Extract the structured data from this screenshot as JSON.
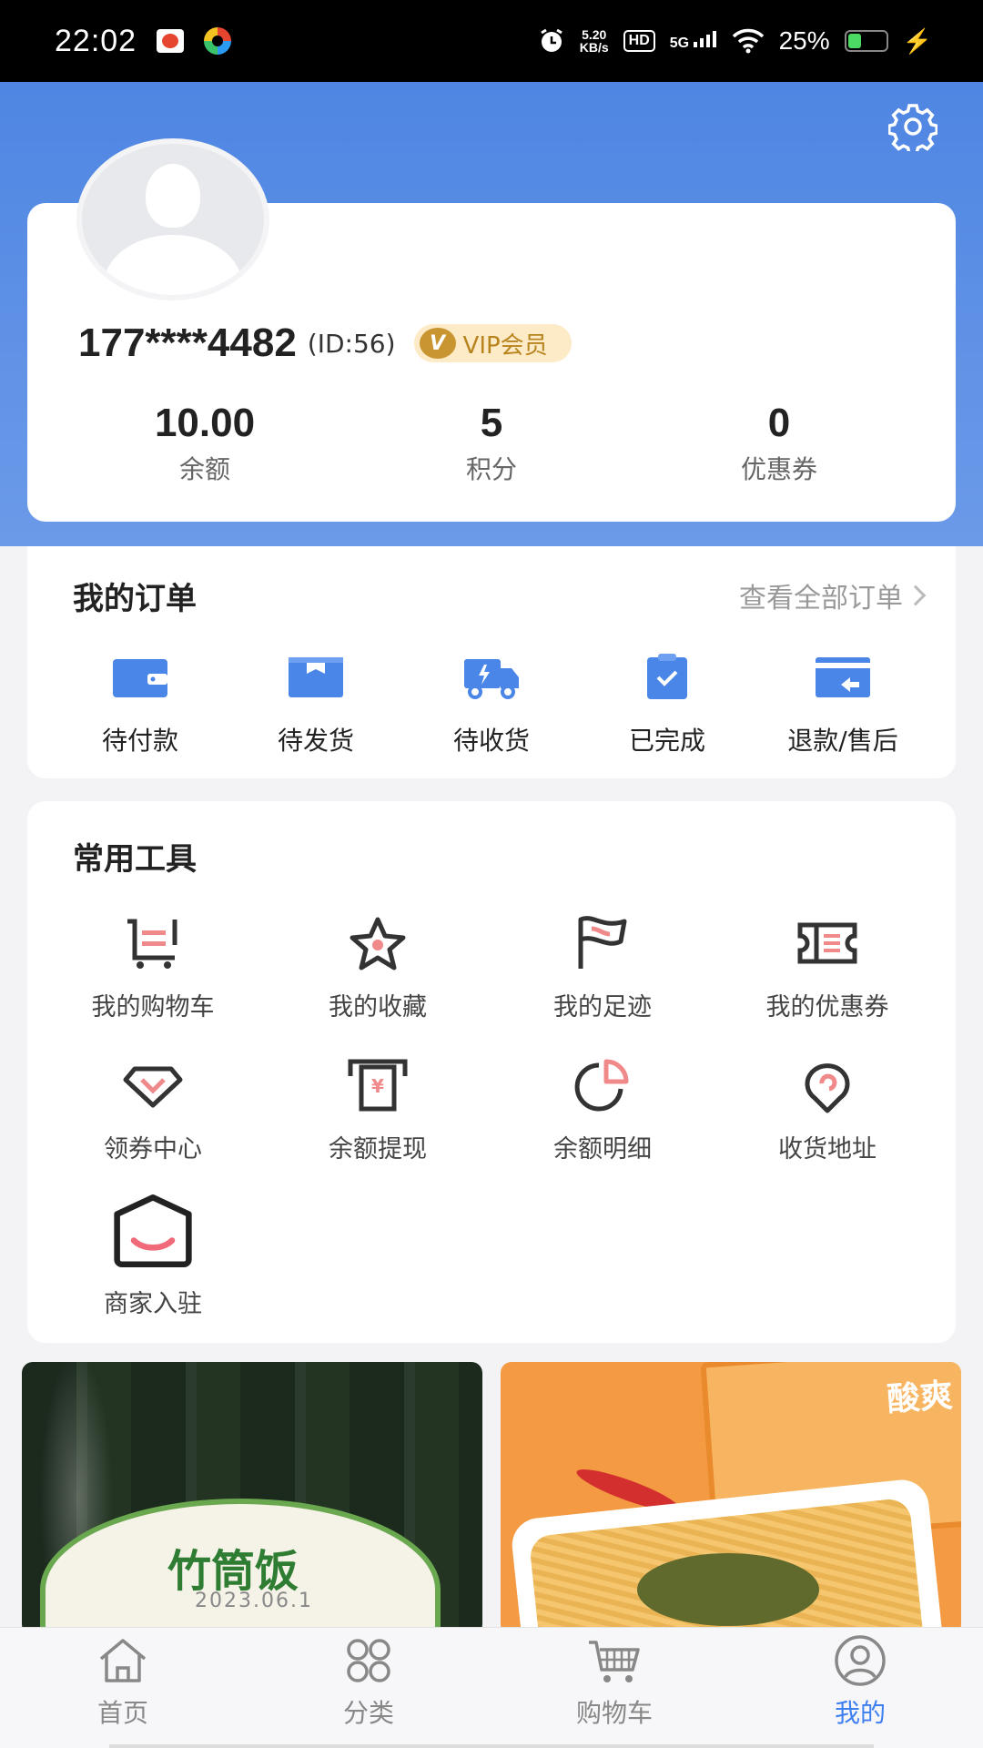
{
  "status_bar": {
    "time": "22:02",
    "net_speed": "5.20",
    "net_unit": "KB/s",
    "hd": "HD",
    "signal": "5G",
    "battery": "25%"
  },
  "profile": {
    "phone": "177****4482",
    "id": "(ID:56)",
    "vip_label": "VIP会员",
    "vip_badge": "V"
  },
  "stats": [
    {
      "value": "10.00",
      "label": "余额"
    },
    {
      "value": "5",
      "label": "积分"
    },
    {
      "value": "0",
      "label": "优惠券"
    }
  ],
  "orders": {
    "title": "我的订单",
    "view_all": "查看全部订单",
    "items": [
      {
        "label": "待付款",
        "icon": "wallet-icon"
      },
      {
        "label": "待发货",
        "icon": "box-icon"
      },
      {
        "label": "待收货",
        "icon": "truck-icon"
      },
      {
        "label": "已完成",
        "icon": "clipboard-check-icon"
      },
      {
        "label": "退款/售后",
        "icon": "refund-icon"
      }
    ]
  },
  "tools": {
    "title": "常用工具",
    "items": [
      {
        "label": "我的购物车",
        "icon": "cart-icon"
      },
      {
        "label": "我的收藏",
        "icon": "star-icon"
      },
      {
        "label": "我的足迹",
        "icon": "flag-icon"
      },
      {
        "label": "我的优惠券",
        "icon": "ticket-icon"
      },
      {
        "label": "领券中心",
        "icon": "diamond-icon"
      },
      {
        "label": "余额提现",
        "icon": "withdraw-icon"
      },
      {
        "label": "余额明细",
        "icon": "pie-icon"
      },
      {
        "label": "收货地址",
        "icon": "location-icon"
      },
      {
        "label": "商家入驻",
        "icon": "shop-icon"
      }
    ]
  },
  "products": [
    {
      "title": "竹筒饭",
      "date": "2023.06.1"
    },
    {
      "title": "酸爽"
    }
  ],
  "tabbar": [
    {
      "label": "首页",
      "icon": "home-icon"
    },
    {
      "label": "分类",
      "icon": "category-icon"
    },
    {
      "label": "购物车",
      "icon": "cart-tab-icon"
    },
    {
      "label": "我的",
      "icon": "profile-icon",
      "active": true
    }
  ],
  "colors": {
    "accent": "#3d7ff0",
    "header_blue": "#4f86e3",
    "order_icon_blue": "#4a86e8",
    "tool_icon_dark": "#333333",
    "tool_icon_pink": "#f08a8a",
    "vip_gold": "#c89530"
  }
}
